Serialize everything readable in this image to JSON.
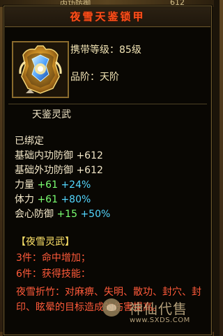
{
  "top_strip": {
    "label": "内功防御",
    "value": "612"
  },
  "tooltip": {
    "title": "夜雪天鉴锁甲",
    "carry_level": "携带等级：85级",
    "grade": "品阶：天阶",
    "spirit_header": "天鉴灵武",
    "bound": "已绑定",
    "stats": {
      "base_internal_label": "基础内功防御",
      "base_internal_value": "+612",
      "base_external_label": "基础外功防御",
      "base_external_value": "+612",
      "strength_label": "力量",
      "strength_value": "+61",
      "strength_bonus": "+24%",
      "stamina_label": "体力",
      "stamina_value": "+61",
      "stamina_bonus": "+80%",
      "crit_def_label": "会心防御",
      "crit_def_value": "+15",
      "crit_def_bonus": "+50%"
    },
    "set": {
      "title": "【夜雪灵武】",
      "three_piece": "3件：命中增加；",
      "six_piece": "6件：获得技能：",
      "effect": "夜雪折竹：对麻痹、失明、散功、封穴、封印、眩晕的目标造成的伤害提高。"
    }
  },
  "watermark": {
    "site_name": "神仙代售",
    "url": "www.SXDS.COM"
  },
  "colors": {
    "title": "#ff4f1a",
    "set_title": "#ffe36a",
    "set_text": "#ff5a3a",
    "bonus_green": "#7bff71",
    "bonus_cyan": "#53d7ff"
  },
  "icons": {
    "item_icon": "armor-chest-icon",
    "watermark_icon": "cat-logo-icon"
  }
}
